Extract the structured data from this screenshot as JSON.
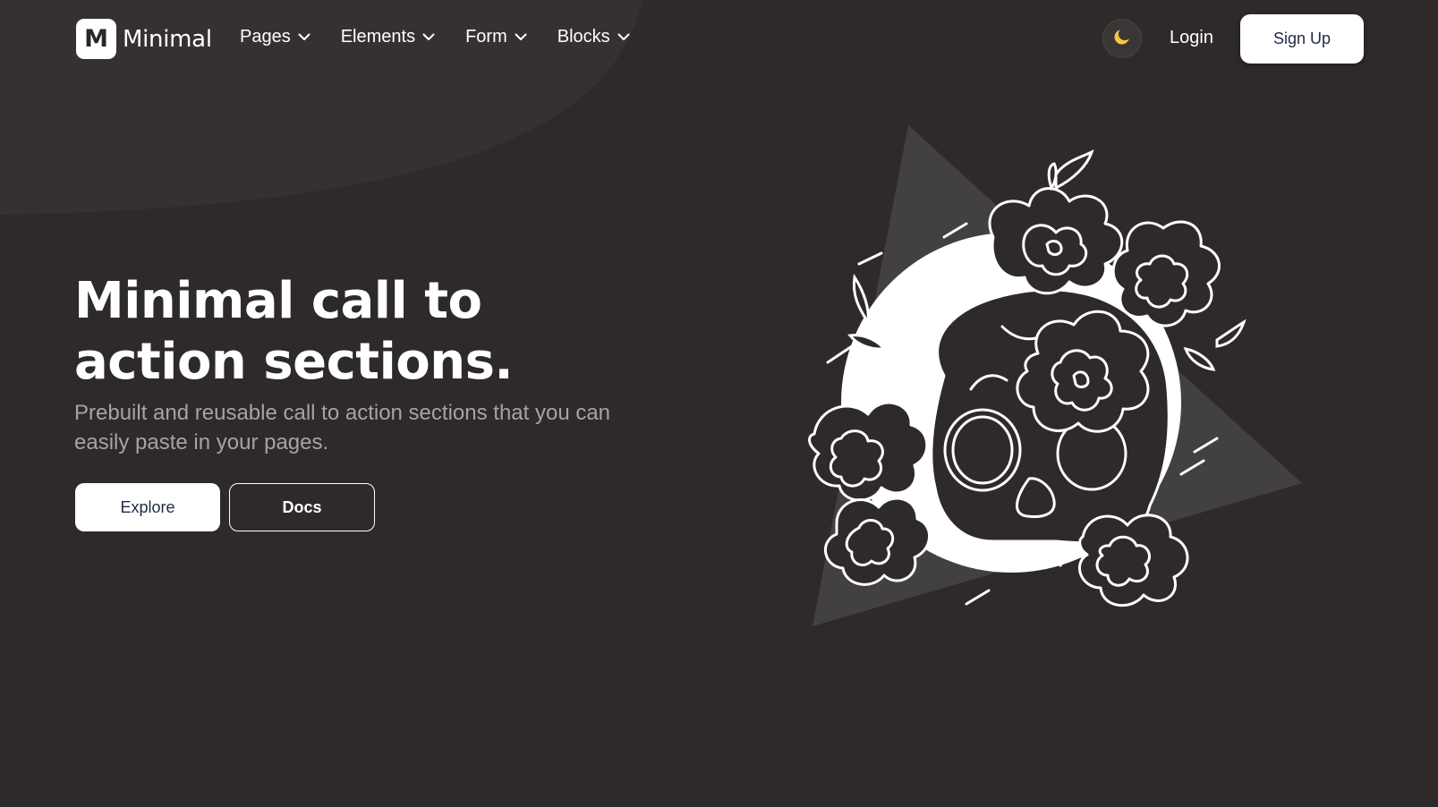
{
  "brand": {
    "logo_letter": "M",
    "name": "Minimal"
  },
  "nav": {
    "items": [
      {
        "label": "Pages"
      },
      {
        "label": "Elements"
      },
      {
        "label": "Form"
      },
      {
        "label": "Blocks"
      }
    ],
    "theme_toggle_icon": "moon-icon",
    "login_label": "Login",
    "signup_label": "Sign Up"
  },
  "hero": {
    "title": "Minimal call to action sections.",
    "subtitle": "Prebuilt and reusable call to action sections that you can easily paste in your pages.",
    "explore_label": "Explore",
    "docs_label": "Docs",
    "illustration_icon": "skull-flowers-illustration"
  },
  "colors": {
    "background": "#2f2a2a",
    "accent_moon": "#f6c544",
    "button_text": "#1f2a44",
    "subtitle_text": "#a9a2a2"
  }
}
